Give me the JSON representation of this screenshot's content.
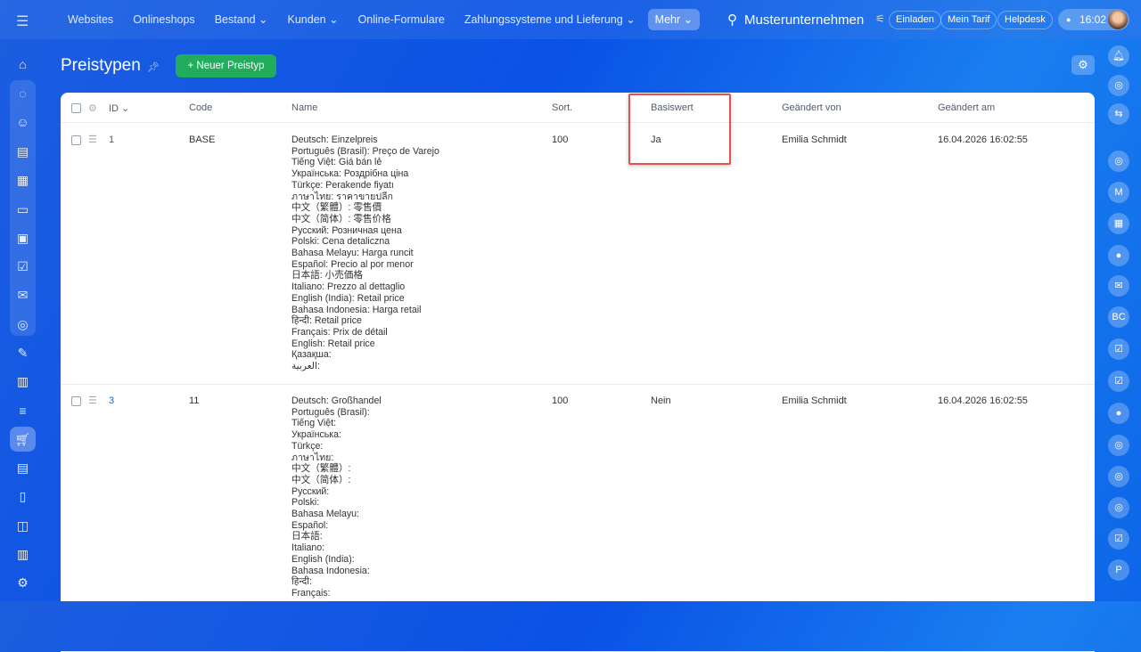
{
  "topbar": {
    "nav": [
      {
        "label": "Websites"
      },
      {
        "label": "Onlineshops"
      },
      {
        "label": "Bestand ⌄"
      },
      {
        "label": "Kunden ⌄"
      },
      {
        "label": "Online-Formulare"
      },
      {
        "label": "Zahlungssysteme und Lieferung ⌄"
      },
      {
        "label": "Mehr ⌄"
      }
    ],
    "company": "Musterunternehmen",
    "invite": "Einladen",
    "plan": "Mein Tarif",
    "helpdesk": "Helpdesk",
    "time": "16:02"
  },
  "page": {
    "title": "Preistypen",
    "new_button": "Neuer Preistyp"
  },
  "table": {
    "headers": {
      "id": "ID ⌄",
      "code": "Code",
      "name": "Name",
      "sort": "Sort.",
      "base": "Basiswert",
      "changed_by": "Geändert von",
      "changed_at": "Geändert am"
    },
    "rows": [
      {
        "id": "1",
        "code": "BASE",
        "sort": "100",
        "base": "Ja",
        "changed_by": "Emilia Schmidt",
        "changed_at": "16.04.2026 16:02:55",
        "names": [
          "Deutsch: Einzelpreis",
          "Português (Brasil): Preço de Varejo",
          "Tiếng Việt: Giá bán lẻ",
          "Українська: Роздрібна ціна",
          "Türkçe: Perakende fiyatı",
          "ภาษาไทย: ราคาขายปลีก",
          "中文（繁體）: 零售價",
          "中文（简体）: 零售价格",
          "Русский: Розничная цена",
          "Polski: Cena detaliczna",
          "Bahasa Melayu: Harga runcit",
          "Español: Precio al por menor",
          "日本語: 小売価格",
          "Italiano: Prezzo al dettaglio",
          "English (India): Retail price",
          "Bahasa Indonesia: Harga retail",
          "हिन्दी: Retail price",
          "Français: Prix de détail",
          "English: Retail price",
          "Қазақша:",
          "العربية:"
        ]
      },
      {
        "id": "3",
        "code": "11",
        "sort": "100",
        "base": "Nein",
        "changed_by": "Emilia Schmidt",
        "changed_at": "16.04.2026 16:02:55",
        "names": [
          "Deutsch: Großhandel",
          "Português (Brasil):",
          "Tiếng Việt:",
          "Українська:",
          "Türkçe:",
          "ภาษาไทย:",
          "中文（繁體）:",
          "中文（简体）:",
          "Русский:",
          "Polski:",
          "Bahasa Melayu:",
          "Español:",
          "日本語:",
          "Italiano:",
          "English (India):",
          "Bahasa Indonesia:",
          "हिन्दी:",
          "Français:"
        ]
      }
    ]
  }
}
